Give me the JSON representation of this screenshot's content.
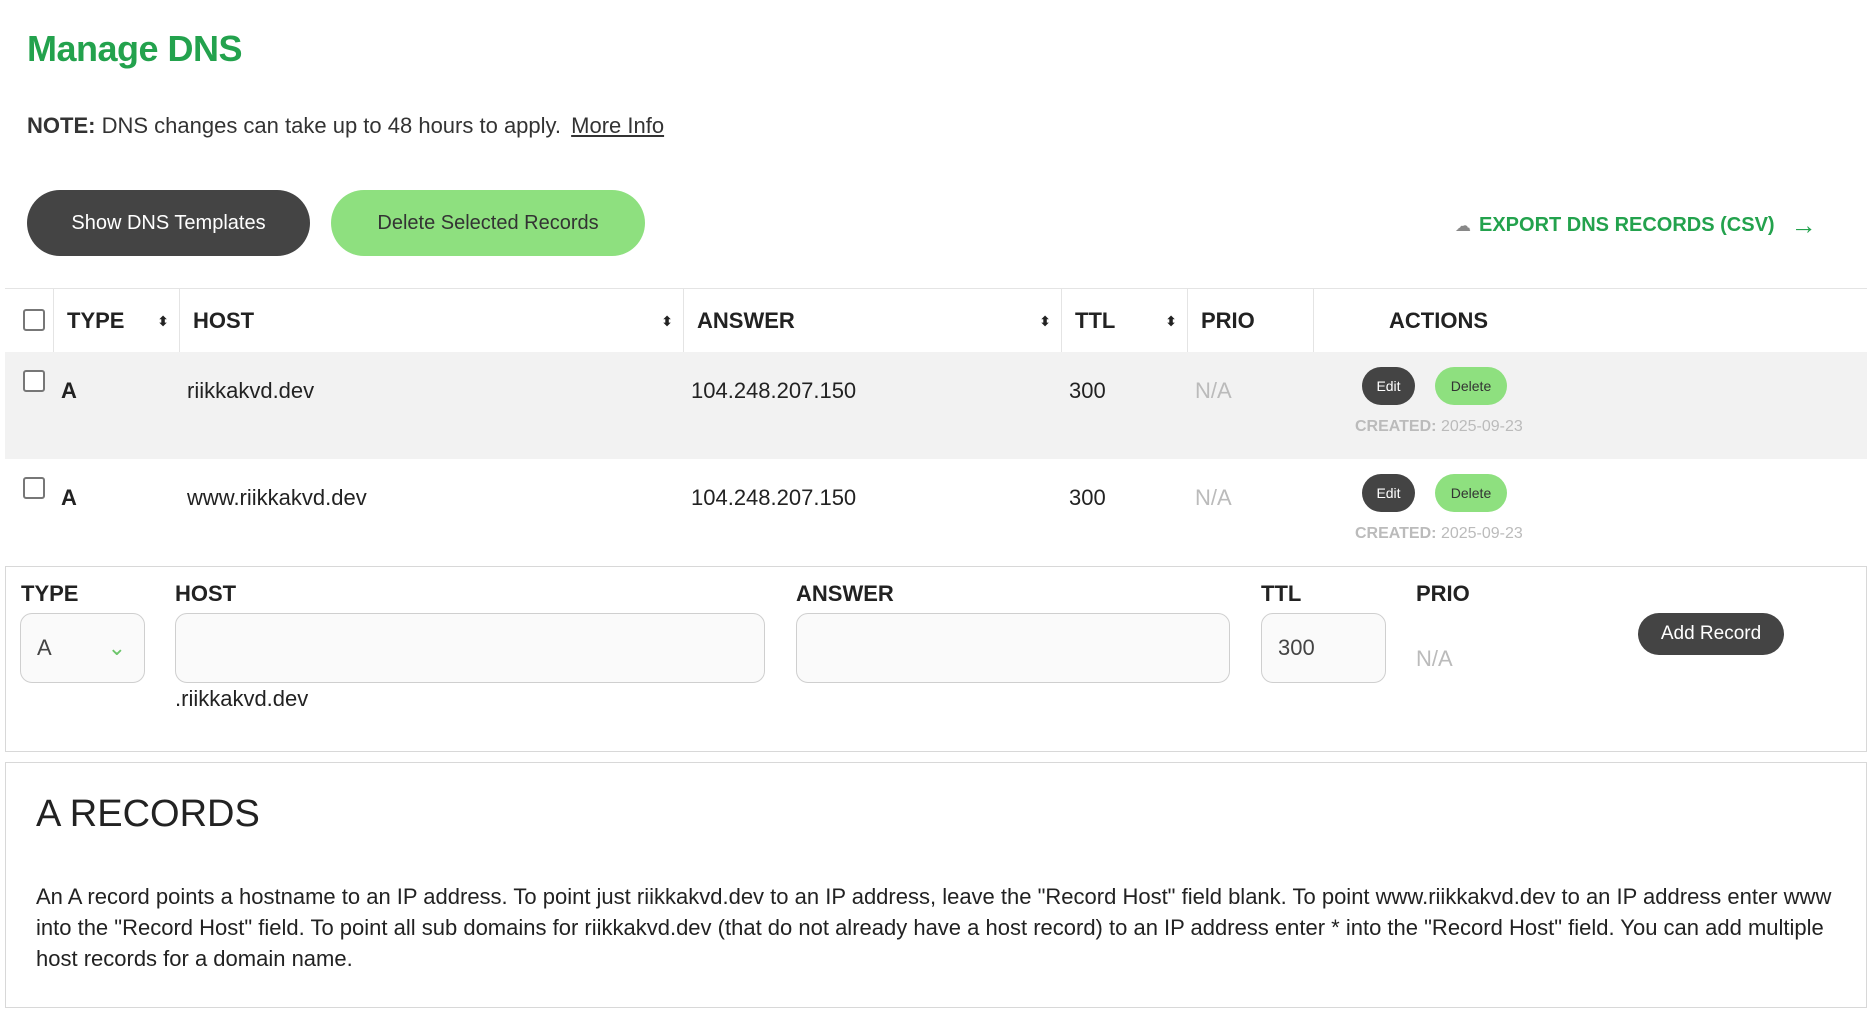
{
  "title": "Manage DNS",
  "note": {
    "label": "NOTE:",
    "text": "DNS changes can take up to 48 hours to apply.",
    "link": "More Info"
  },
  "buttons": {
    "show_templates": "Show DNS Templates",
    "delete_selected": "Delete Selected Records",
    "export": "EXPORT DNS RECORDS (CSV)"
  },
  "columns": {
    "type": "TYPE",
    "host": "HOST",
    "answer": "ANSWER",
    "ttl": "TTL",
    "prio": "PRIO",
    "actions": "ACTIONS"
  },
  "records": [
    {
      "type": "A",
      "host": "riikkakvd.dev",
      "answer": "104.248.207.150",
      "ttl": "300",
      "prio": "N/A",
      "edit": "Edit",
      "delete": "Delete",
      "created_label": "CREATED:",
      "created": "2025-09-23"
    },
    {
      "type": "A",
      "host": "www.riikkakvd.dev",
      "answer": "104.248.207.150",
      "ttl": "300",
      "prio": "N/A",
      "edit": "Edit",
      "delete": "Delete",
      "created_label": "CREATED:",
      "created": "2025-09-23"
    }
  ],
  "add_form": {
    "type_label": "TYPE",
    "host_label": "HOST",
    "answer_label": "ANSWER",
    "ttl_label": "TTL",
    "prio_label": "PRIO",
    "type_value": "A",
    "host_value": "",
    "host_suffix": ".riikkakvd.dev",
    "answer_value": "",
    "ttl_value": "300",
    "prio_value": "N/A",
    "add_button": "Add Record"
  },
  "info": {
    "heading": "A RECORDS",
    "body": "An A record points a hostname to an IP address. To point just riikkakvd.dev to an IP address, leave the \"Record Host\" field blank. To point www.riikkakvd.dev to an IP address enter www into the \"Record Host\" field. To point all sub domains for riikkakvd.dev (that do not already have a host record) to an IP address enter * into the \"Record Host\" field. You can add multiple host records for a domain name."
  },
  "colors": {
    "brand_green": "#23a24d",
    "button_green": "#8ee07f",
    "button_dark": "#444444"
  }
}
